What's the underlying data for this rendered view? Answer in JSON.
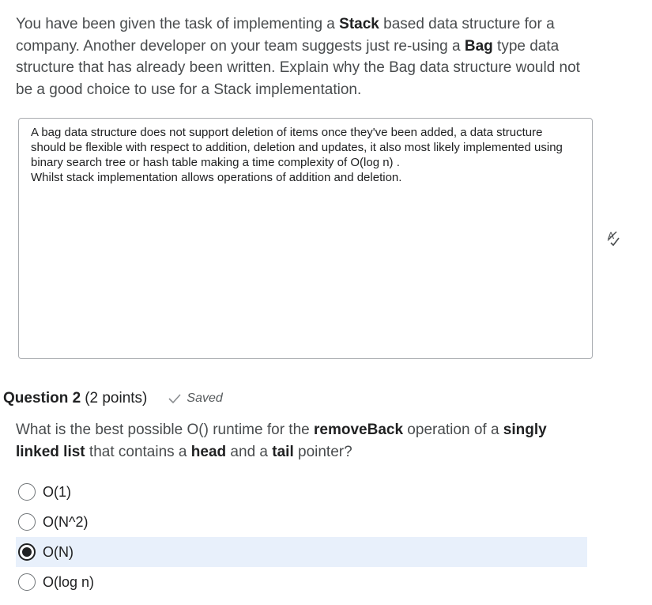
{
  "question1": {
    "prompt_parts": [
      "You have been given the task of implementing a ",
      "Stack",
      " based data structure for a company. Another developer on your team suggests just re-using a ",
      "Bag",
      " type data structure that has already been written. Explain why the Bag data structure would not be a good choice to use for a Stack implementation."
    ],
    "answer_text": "A bag data structure does not support deletion of items once they've been added, a data structure should be flexible with respect to addition, deletion and updates, it also most likely implemented using binary search tree or hash table making a time complexity of O(log n) .\nWhilst stack implementation allows operations of addition and deletion."
  },
  "question2": {
    "title": "Question 2",
    "points": "(2 points)",
    "status": "Saved",
    "prompt_parts": [
      "What is the best possible O() runtime for the ",
      "removeBack",
      " operation of a ",
      "singly linked list",
      " that contains a ",
      "head",
      " and a ",
      "tail",
      " pointer?"
    ],
    "options": [
      {
        "label": "O(1)",
        "selected": false
      },
      {
        "label": "O(N^2)",
        "selected": false
      },
      {
        "label": "O(N)",
        "selected": true
      },
      {
        "label": "O(log n)",
        "selected": false
      }
    ]
  },
  "icons": {
    "spellcheck": "spellcheck-icon",
    "saved": "checkmark-icon"
  },
  "colors": {
    "selected_row": "#e8f0fb",
    "text": "#202122",
    "muted": "#494c4e"
  }
}
